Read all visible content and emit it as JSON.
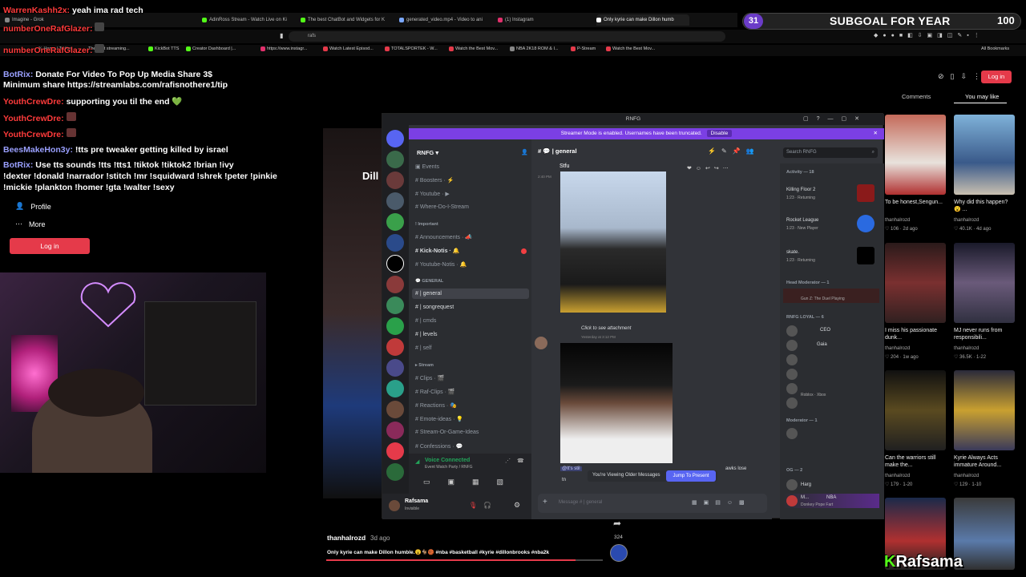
{
  "browser": {
    "tabs": [
      {
        "label": "Imagine - Grok"
      },
      {
        "label": "AdinRoss Stream - Watch Live on Ki"
      },
      {
        "label": "The best ChatBot and Widgets for K"
      },
      {
        "label": "generated_video.mp4 - Video to ani"
      },
      {
        "label": "(1) Instagram"
      },
      {
        "label": "Only kyrie can make Dillon humb"
      }
    ],
    "url": "rafs",
    "bookmarks": [
      {
        "label": "Home / Twitter"
      },
      {
        "label": "The best streaming..."
      },
      {
        "label": "KickBot TTS"
      },
      {
        "label": "Creator Dashboard |..."
      },
      {
        "label": "https://www.instagr..."
      },
      {
        "label": "Watch Latest Episod..."
      },
      {
        "label": "TOTALSPORTEK - W..."
      },
      {
        "label": "Watch the Best Mov..."
      },
      {
        "label": "NBA 2K18 ROM & I..."
      },
      {
        "label": "P-Stream"
      },
      {
        "label": "Watch the Best Mov..."
      },
      {
        "label": "All Bookmarks"
      }
    ]
  },
  "chat_overlay": [
    {
      "user": "WarrenKashh2x:",
      "msg": "yeah ima rad tech"
    },
    {
      "user": "numberOneRafGlazer:",
      "msg": ""
    },
    {
      "user": "numberOneRafGlazer:",
      "msg": ""
    },
    {
      "user": "BotRix:",
      "msg": "Donate For Video To Pop Up Media Share 3$"
    },
    {
      "user": "",
      "msg": "Minimum share https://streamlabs.com/rafisnothere1/tip"
    },
    {
      "user": "YouthCrewDre:",
      "msg": "supporting you til the end 💚"
    },
    {
      "user": "YouthCrewDre:",
      "msg": ""
    },
    {
      "user": "YouthCrewDre:",
      "msg": ""
    },
    {
      "user": "BeesMakeHon3y:",
      "msg": "!tts pre tweaker getting killed by israel"
    },
    {
      "user": "BotRix:",
      "msg": "Use tts sounds !tts !tts1 !tiktok !tiktok2 !brian !ivy"
    },
    {
      "user": "",
      "msg": "!dexter !donald !narrador !stitch !mr !squidward !shrek !peter !pinkie"
    },
    {
      "user": "",
      "msg": "!mickie !plankton !homer !gta !walter !sexy"
    }
  ],
  "kick_nav": {
    "items": [
      {
        "label": "Profile"
      },
      {
        "label": "More"
      }
    ],
    "login": "Log in"
  },
  "goal": {
    "current": "31",
    "title": "SUBGOAL FOR YEAR",
    "target": "100"
  },
  "tiktok": {
    "login": "Log in",
    "tabs": [
      {
        "label": "Comments"
      },
      {
        "label": "You may like"
      }
    ],
    "videos": [
      {
        "caption": "To be honest,Sengun...",
        "user": "thanhalrozd",
        "stats": "♡ 106 · 2d ago"
      },
      {
        "caption": "Why did this happen?😮 ...",
        "user": "thanhalrozd",
        "stats": "♡ 40.1K · 4d ago"
      },
      {
        "caption": "I miss his passionate dunk...",
        "user": "thanhalrozd",
        "stats": "♡ 204 · 1w ago"
      },
      {
        "caption": "MJ never runs from responsibili...",
        "user": "thanhalrozd",
        "stats": "♡ 36.5K · 1-22"
      },
      {
        "caption": "Can the warriors still make the...",
        "user": "thanhalrozd",
        "stats": "♡ 179 · 1-20"
      },
      {
        "caption": "Kyrie Always Acts immature Around...",
        "user": "thanhalrozd",
        "stats": "♡ 129 · 1-10"
      }
    ],
    "bottom_user": "thanhalrozd",
    "bottom_date": "3d ago",
    "bottom_caption": "Only kyrie can make Dillon humble.😮🐐🏀 #nba #basketball #kyrie #dillonbrooks #nba2k",
    "share_count": "324",
    "progress": 0.9
  },
  "discord": {
    "window_title": "RNFG",
    "banner": "Streamer Mode is enabled. Usernames have been truncated.",
    "banner_button": "Disable",
    "server_name": "RNFG",
    "channel_header": "| general",
    "search": "Search RNFG",
    "channels": [
      {
        "label": "Events",
        "type": "item"
      },
      {
        "label": "Boosters · ⚡",
        "type": "item"
      },
      {
        "label": "Youtube · ▶",
        "type": "item"
      },
      {
        "label": "Where-Do-I-Stream",
        "type": "item"
      },
      {
        "label": "Important",
        "type": "cat"
      },
      {
        "label": "Announcements · 📣",
        "type": "item"
      },
      {
        "label": "Kick-Notis · 🔔",
        "type": "bright"
      },
      {
        "label": "Youtube-Notis · 🔔",
        "type": "item"
      },
      {
        "label": "GENERAL",
        "type": "cat"
      },
      {
        "label": "| general",
        "type": "bright"
      },
      {
        "label": "| songrequest",
        "type": "bright"
      },
      {
        "label": "| cmds",
        "type": "item"
      },
      {
        "label": "| levels",
        "type": "bright"
      },
      {
        "label": "| self",
        "type": "item"
      },
      {
        "label": "Stream",
        "type": "cat"
      },
      {
        "label": "Clips · 🎬",
        "type": "item"
      },
      {
        "label": "Raf-Clips · 🎬",
        "type": "item"
      },
      {
        "label": "Reactions · 🎭",
        "type": "item"
      },
      {
        "label": "Emote-ideas · 💡",
        "type": "item"
      },
      {
        "label": "Stream-Or-Game-Ideas",
        "type": "item"
      },
      {
        "label": "Confessions · 💬",
        "type": "item"
      }
    ],
    "voice_status": "Voice Connected",
    "voice_channel": "Event Watch Party / RNFG",
    "user_name": "Rafsama",
    "user_status": "Invisible",
    "msg_top": "Stfu",
    "msg_time_top": "2:40 PM",
    "msg_attachment": "Click to see attachment",
    "msg_time": "Yesterday at 3:12 PM",
    "msg_partial": "@It's stil",
    "msg_partial_tail": "awks lose",
    "msg_partial_line": "tn",
    "older_notice": "You're Viewing Older Messages",
    "jump_button": "Jump To Present",
    "input_placeholder": "Message #  | general",
    "members": {
      "activity_header": "Activity — 18",
      "activities": [
        {
          "game": "Killing Floor 2",
          "sub": "1:23 · Returning"
        },
        {
          "game": "Rocket League",
          "sub": "1:23 · New Player"
        },
        {
          "game": "skate.",
          "sub": "1:23 · Returning"
        }
      ],
      "head_mod_header": "Head Moderator — 1",
      "head_mod_game": "Gun Z: The Duel Playing",
      "loyal_header": "RNFG LOYAL — 6",
      "loyal_names": [
        "CEO",
        "Gaia",
        "",
        "",
        "Roblox · Xbox",
        ""
      ],
      "mod_header": "Moderator — 1",
      "og_header": "OG — 2",
      "og_names": [
        "Harg",
        "M..."
      ],
      "og_tag": "NBA",
      "og_sub": "Donkey Pope Fart"
    }
  },
  "video_overlay_text": "Dill",
  "streamer_name": "Rafsama",
  "colors": {
    "accent": "#7b3fe4",
    "kick_red": "#e53a4a",
    "discord_bg": "#313338"
  }
}
